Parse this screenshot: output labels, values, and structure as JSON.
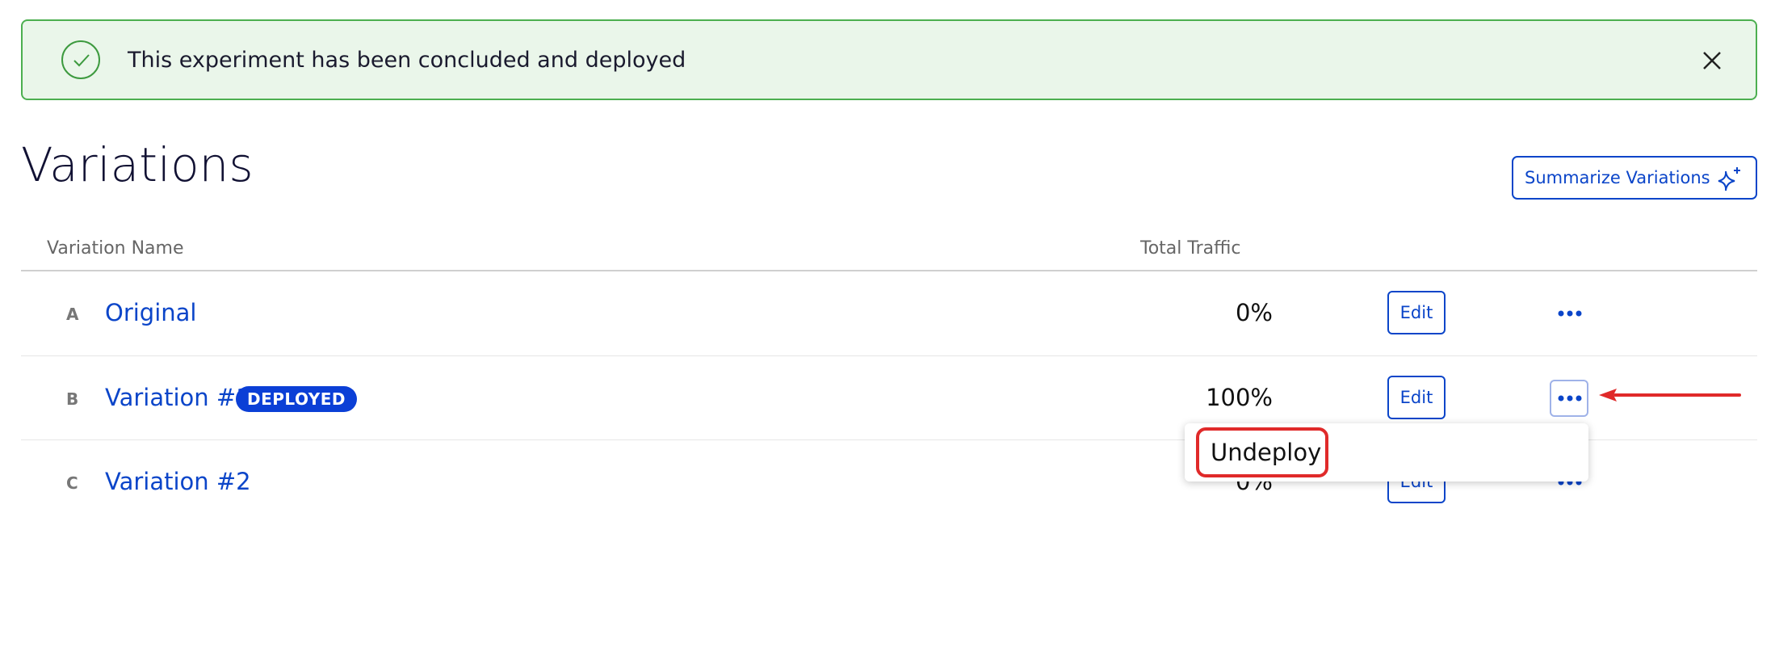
{
  "banner": {
    "message": "This experiment has been concluded and deployed",
    "status_color": "#4caf50"
  },
  "header": {
    "title": "Variations",
    "summarize_label": "Summarize Variations"
  },
  "table": {
    "columns": [
      "Variation Name",
      "Total Traffic"
    ],
    "rows": [
      {
        "letter": "A",
        "name": "Original",
        "badge": "",
        "traffic": "0%",
        "edit_label": "Edit"
      },
      {
        "letter": "B",
        "name": "Variation #1",
        "badge": "DEPLOYED",
        "traffic": "100%",
        "edit_label": "Edit"
      },
      {
        "letter": "C",
        "name": "Variation #2",
        "badge": "",
        "traffic": "0%",
        "edit_label": "Edit"
      }
    ]
  },
  "menu": {
    "items": [
      {
        "label": "Undeploy"
      }
    ]
  },
  "colors": {
    "accent": "#0b45c9",
    "badge": "#0b3fd6",
    "annotation": "#e02a2a"
  },
  "icons": {
    "banner": "check-circle-icon",
    "close": "close-icon",
    "summarize": "sparkle-icon",
    "more": "ellipsis-icon",
    "annotation": "arrow-left-icon"
  }
}
